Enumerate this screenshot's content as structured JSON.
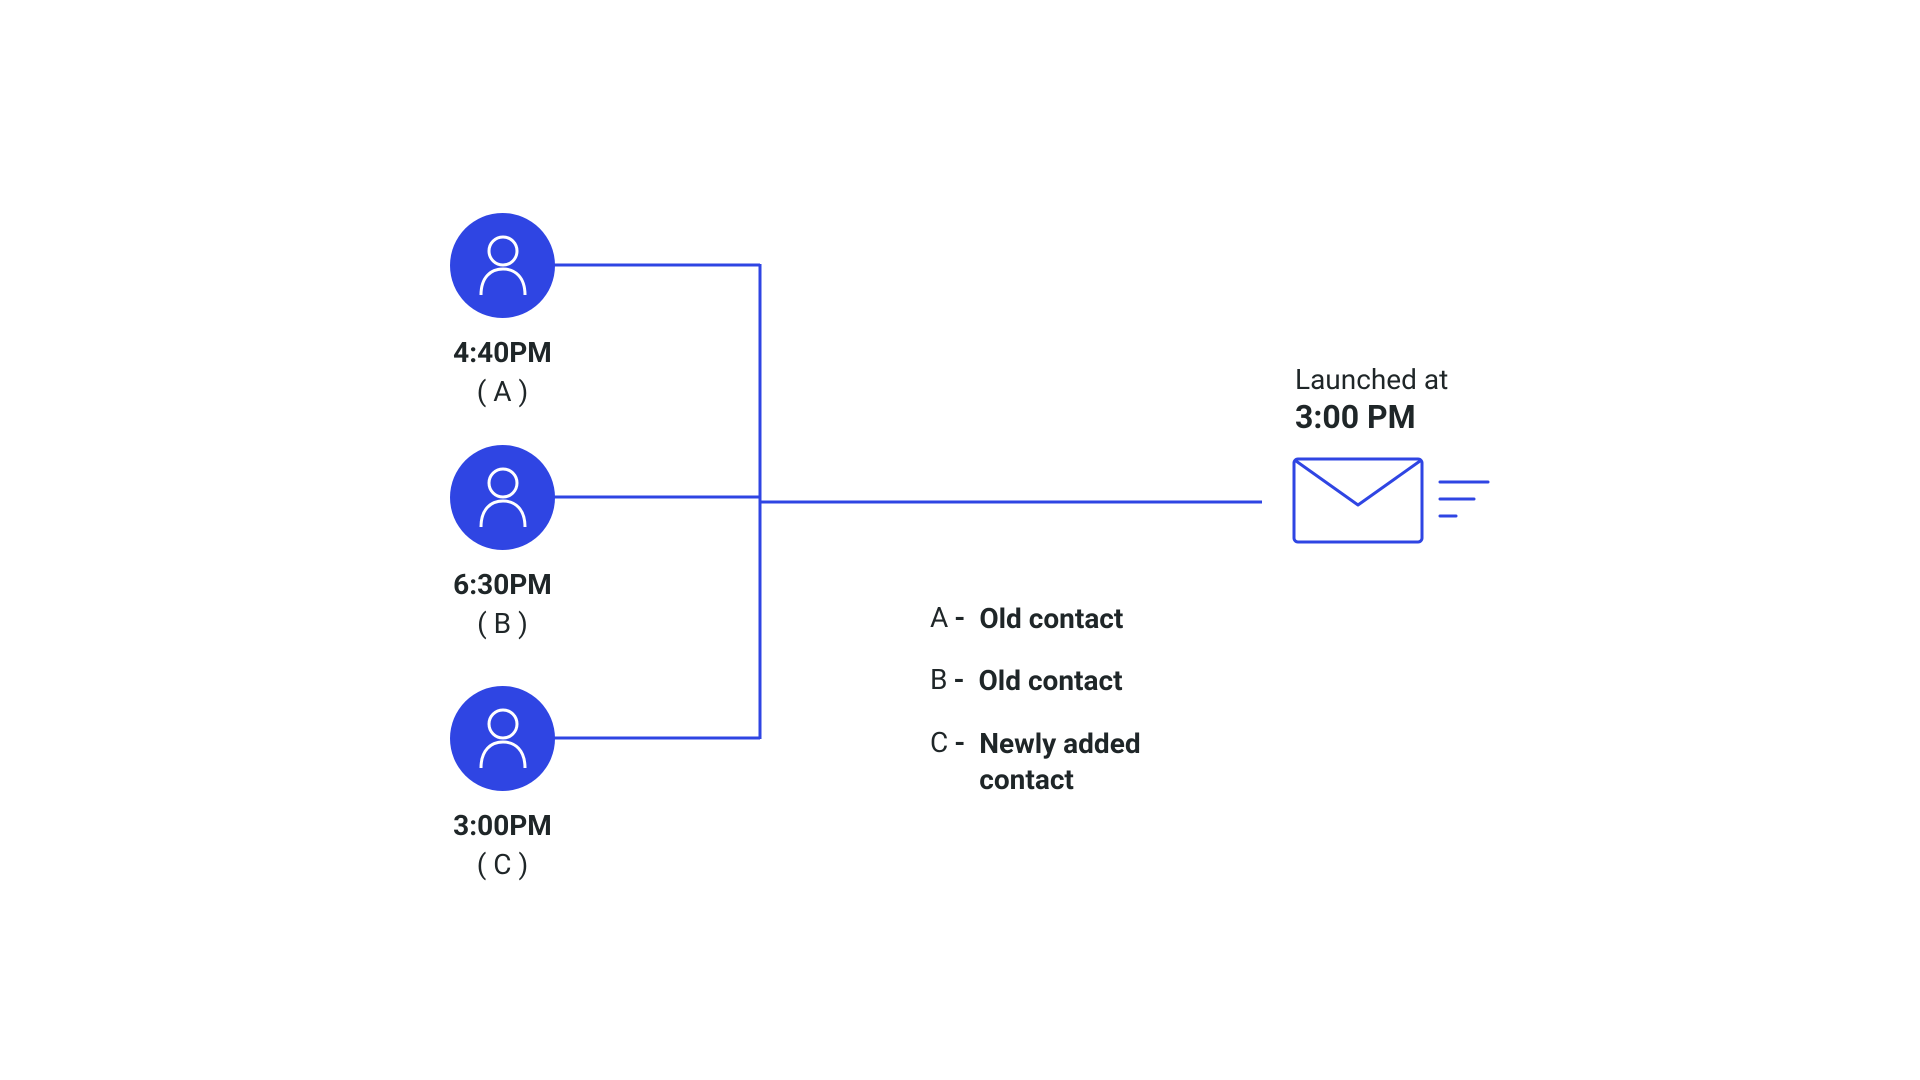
{
  "colors": {
    "primary": "#2f45e3",
    "text": "#1f2628",
    "line": "#2f45e3"
  },
  "contacts": [
    {
      "time": "4:40PM",
      "label": "( A )"
    },
    {
      "time": "6:30PM",
      "label": "( B )"
    },
    {
      "time": "3:00PM",
      "label": "( C )"
    }
  ],
  "launched": {
    "label": "Launched at",
    "time": "3:00 PM"
  },
  "legend": [
    {
      "key": "A",
      "text": "Old contact"
    },
    {
      "key": "B",
      "text": "Old contact"
    },
    {
      "key": "C",
      "text": "Newly added contact"
    }
  ]
}
